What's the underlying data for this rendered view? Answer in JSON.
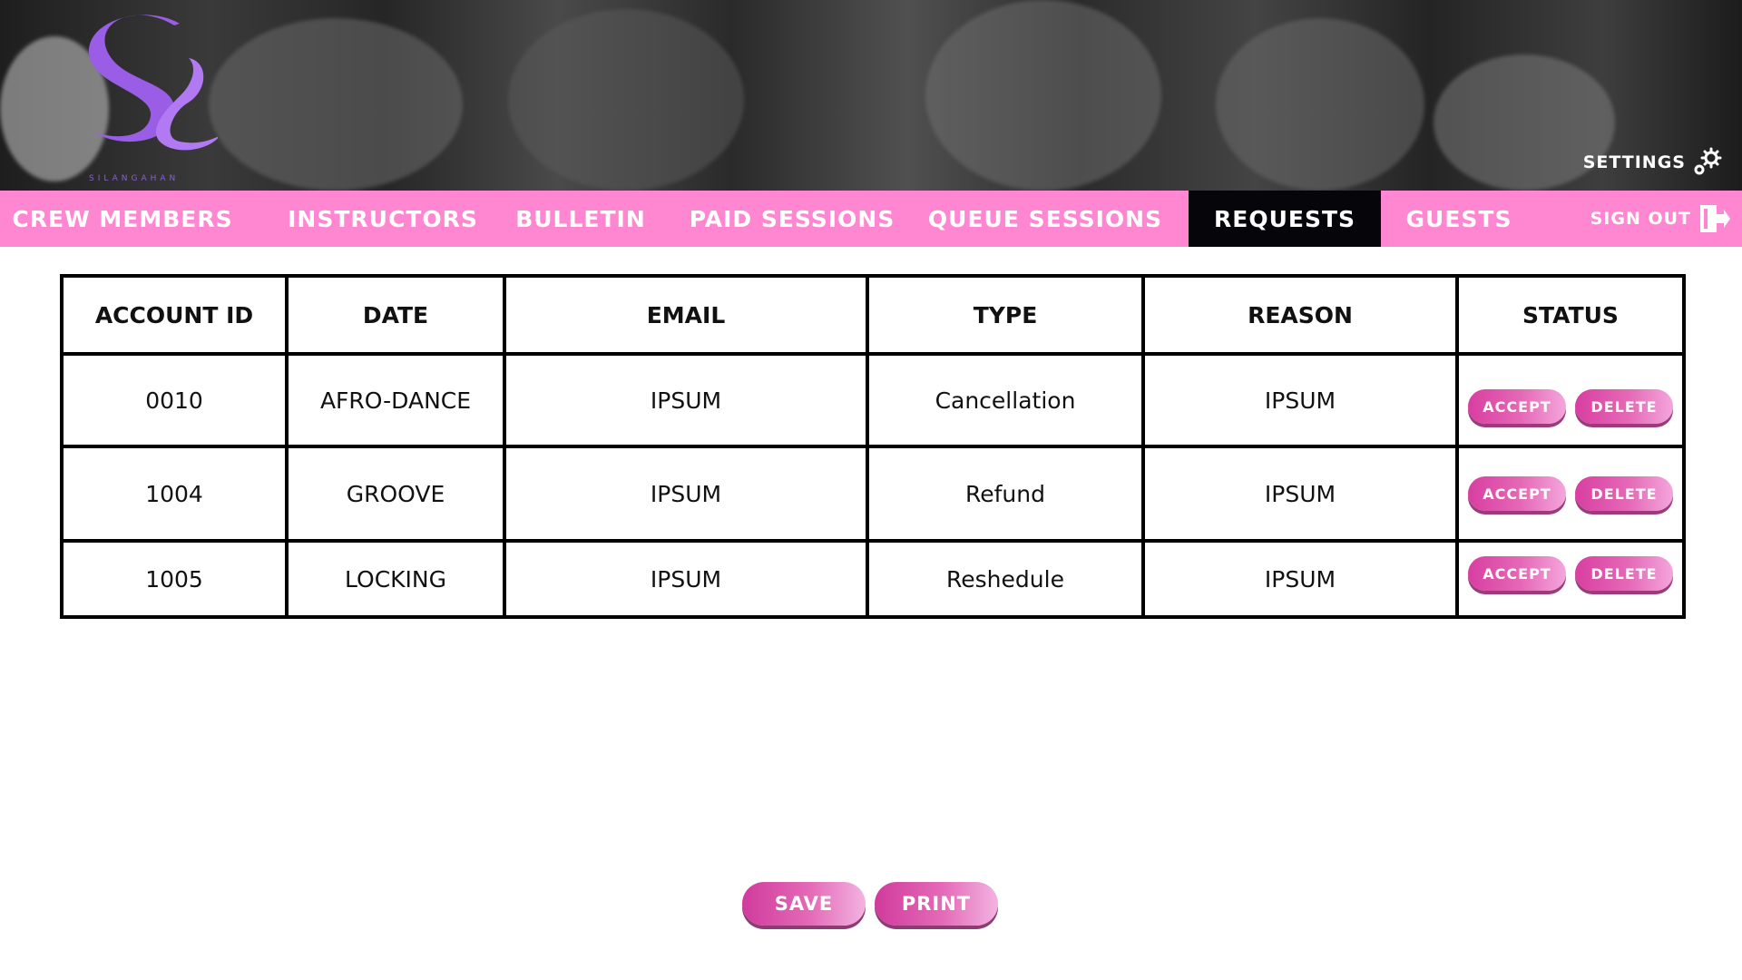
{
  "brand": {
    "logo_text": "SILANGAHAN",
    "logo_icon": "sl-monogram-logo"
  },
  "header": {
    "settings_label": "SETTINGS",
    "settings_icon": "gear-icon"
  },
  "nav": {
    "items": [
      {
        "label": "CREW MEMBERS"
      },
      {
        "label": "INSTRUCTORS"
      },
      {
        "label": "BULLETIN"
      },
      {
        "label": "PAID SESSIONS"
      },
      {
        "label": "QUEUE SESSIONS"
      },
      {
        "label": "REQUESTS",
        "active": true
      },
      {
        "label": "GUESTS"
      }
    ],
    "signout_label": "SIGN OUT",
    "signout_icon": "sign-out-icon"
  },
  "table": {
    "headers": [
      "ACCOUNT ID",
      "DATE",
      "EMAIL",
      "TYPE",
      "REASON",
      "STATUS"
    ],
    "rows": [
      {
        "account_id": "0010",
        "date": "AFRO-DANCE",
        "email": "IPSUM",
        "type": "Cancellation",
        "reason": "IPSUM"
      },
      {
        "account_id": "1004",
        "date": "GROOVE",
        "email": "IPSUM",
        "type": "Refund",
        "reason": "IPSUM"
      },
      {
        "account_id": "1005",
        "date": "LOCKING",
        "email": "IPSUM",
        "type": "Reshedule",
        "reason": "IPSUM"
      }
    ],
    "accept_label": "ACCEPT",
    "delete_label": "DELETE"
  },
  "actions": {
    "save_label": "SAVE",
    "print_label": "PRINT"
  },
  "colors": {
    "nav_bg": "#ff86d1",
    "nav_active_bg": "#05050a",
    "button_pink": "#d83ea0",
    "logo_purple": "#8e5bdc"
  }
}
